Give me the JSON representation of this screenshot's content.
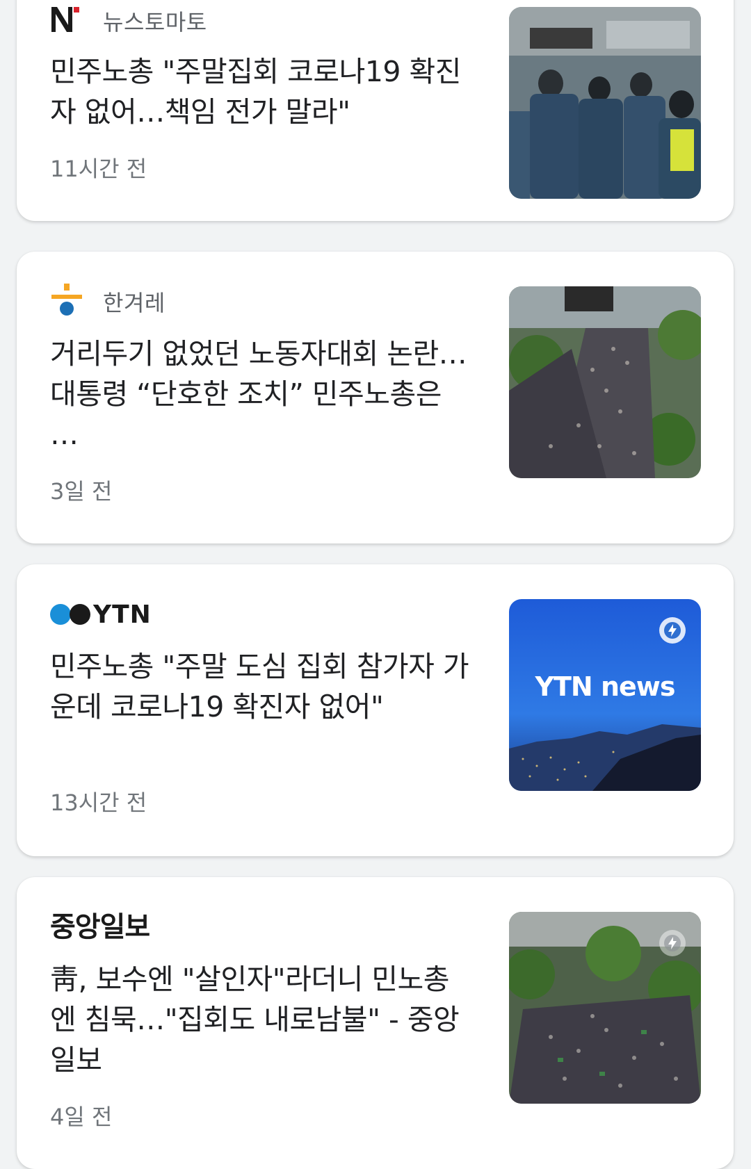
{
  "articles": [
    {
      "source": "뉴스토마토",
      "headline": "민주노총 \"주말집회 코로나19 확진자 없어…책임 전가 말라\"",
      "time": "11시간 전",
      "logo_icon": "newstomato-logo-icon",
      "thumb_icon": "police-officers-photo"
    },
    {
      "source": "한겨레",
      "headline": "거리두기 없었던 노동자대회 논란…대통령 “단호한 조치” 민주노총은 …",
      "time": "3일 전",
      "logo_icon": "hankyoreh-logo-icon",
      "thumb_icon": "street-rally-crowd-photo"
    },
    {
      "source_logo_text": "YTN",
      "headline": "민주노총 \"주말 도심 집회 참가자 가운데 코로나19 확진자 없어\"",
      "time": "13시간 전",
      "logo_icon": "ytn-logo-icon",
      "thumb_text": "YTN news",
      "thumb_icon": "ytn-news-thumbnail",
      "badge_icon": "amp-lightning-icon"
    },
    {
      "source_logo_text": "중앙일보",
      "headline": "靑, 보수엔 \"살인자\"라더니 민노총엔 침묵…\"집회도 내로남불\" - 중앙일보",
      "time": "4일 전",
      "logo_icon": "joongang-logo-icon",
      "thumb_icon": "street-rally-crowd-photo",
      "badge_icon": "amp-lightning-icon"
    }
  ],
  "colors": {
    "background": "#f1f3f4",
    "card": "#ffffff",
    "headline": "#202124",
    "meta": "#70757a",
    "ytn_blue": "#1a8fd8",
    "hankyoreh_orange": "#f5a623",
    "hankyoreh_blue": "#1c6fb5",
    "newstomato_red": "#d9232d"
  }
}
